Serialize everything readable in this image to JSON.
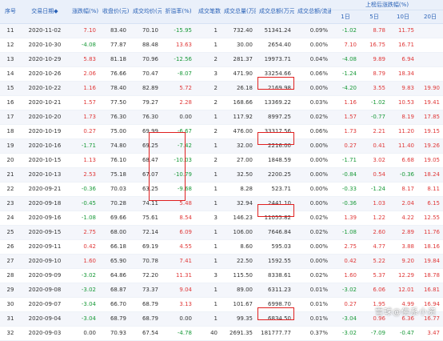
{
  "headers": {
    "top_group": "上榜后涨跌幅(%)",
    "cols": [
      "序号",
      "交易日期",
      "涨跌幅(%)",
      "收盘价(元)",
      "成交均价(元)",
      "折溢率(%)",
      "成交笔数",
      "成交总量(万股)",
      "成交总额(万元)",
      "成交总额/流通市值",
      "1日",
      "5日",
      "10日",
      "20日"
    ]
  },
  "rows": [
    [
      "11",
      "2020-11-02",
      "7.10",
      "83.40",
      "70.10",
      "-15.95",
      "1",
      "732.40",
      "51341.24",
      "0.09%",
      "-1.02",
      "8.78",
      "11.75",
      ""
    ],
    [
      "12",
      "2020-10-30",
      "-4.08",
      "77.87",
      "88.48",
      "13.63",
      "1",
      "30.00",
      "2654.40",
      "0.00%",
      "7.10",
      "16.75",
      "16.71",
      ""
    ],
    [
      "13",
      "2020-10-29",
      "5.83",
      "81.18",
      "70.96",
      "-12.56",
      "2",
      "281.37",
      "19973.71",
      "0.04%",
      "-4.08",
      "9.89",
      "6.94",
      ""
    ],
    [
      "14",
      "2020-10-26",
      "2.06",
      "76.66",
      "70.47",
      "-8.07",
      "3",
      "471.90",
      "33254.66",
      "0.06%",
      "-1.24",
      "8.79",
      "18.34",
      ""
    ],
    [
      "15",
      "2020-10-22",
      "1.16",
      "78.40",
      "82.89",
      "5.72",
      "2",
      "26.18",
      "2169.98",
      "0.00%",
      "-4.20",
      "3.55",
      "9.83",
      "19.90"
    ],
    [
      "16",
      "2020-10-21",
      "1.57",
      "77.50",
      "79.27",
      "2.28",
      "2",
      "168.66",
      "13369.22",
      "0.03%",
      "1.16",
      "-1.02",
      "10.53",
      "19.41"
    ],
    [
      "17",
      "2020-10-20",
      "1.73",
      "76.30",
      "76.30",
      "0.00",
      "1",
      "117.92",
      "8997.25",
      "0.02%",
      "1.57",
      "-0.77",
      "8.19",
      "17.85"
    ],
    [
      "18",
      "2020-10-19",
      "0.27",
      "75.00",
      "69.99",
      "-6.67",
      "2",
      "476.00",
      "33317.56",
      "0.06%",
      "1.73",
      "2.21",
      "11.20",
      "19.15"
    ],
    [
      "19",
      "2020-10-16",
      "-1.71",
      "74.80",
      "69.25",
      "-7.42",
      "1",
      "32.00",
      "2216.00",
      "0.00%",
      "0.27",
      "0.41",
      "11.40",
      "19.26"
    ],
    [
      "20",
      "2020-10-15",
      "1.13",
      "76.10",
      "68.47",
      "-10.03",
      "2",
      "27.00",
      "1848.59",
      "0.00%",
      "-1.71",
      "3.02",
      "6.68",
      "19.05"
    ],
    [
      "21",
      "2020-10-13",
      "2.53",
      "75.18",
      "67.07",
      "-10.79",
      "1",
      "32.50",
      "2200.25",
      "0.00%",
      "-0.84",
      "0.54",
      "-0.36",
      "18.24"
    ],
    [
      "22",
      "2020-09-21",
      "-0.36",
      "70.03",
      "63.25",
      "-9.68",
      "1",
      "8.28",
      "523.71",
      "0.00%",
      "-0.33",
      "-1.24",
      "8.17",
      "8.11"
    ],
    [
      "23",
      "2020-09-18",
      "-0.45",
      "70.28",
      "74.11",
      "5.48",
      "1",
      "32.94",
      "2441.10",
      "0.00%",
      "-0.36",
      "1.03",
      "2.04",
      "6.15"
    ],
    [
      "24",
      "2020-09-16",
      "-1.08",
      "69.66",
      "75.61",
      "8.54",
      "3",
      "146.23",
      "11055.82",
      "0.02%",
      "1.39",
      "1.22",
      "4.22",
      "12.55"
    ],
    [
      "25",
      "2020-09-15",
      "2.75",
      "68.00",
      "72.14",
      "6.09",
      "1",
      "106.00",
      "7646.84",
      "0.02%",
      "-1.08",
      "2.60",
      "2.89",
      "11.76"
    ],
    [
      "26",
      "2020-09-11",
      "0.42",
      "66.18",
      "69.19",
      "4.55",
      "1",
      "8.60",
      "595.03",
      "0.00%",
      "2.75",
      "4.77",
      "3.88",
      "18.16"
    ],
    [
      "27",
      "2020-09-10",
      "1.60",
      "65.90",
      "70.78",
      "7.41",
      "1",
      "22.50",
      "1592.55",
      "0.00%",
      "0.42",
      "5.22",
      "9.20",
      "19.84"
    ],
    [
      "28",
      "2020-09-09",
      "-3.02",
      "64.86",
      "72.20",
      "11.31",
      "3",
      "115.50",
      "8338.61",
      "0.02%",
      "1.60",
      "5.37",
      "12.29",
      "18.78"
    ],
    [
      "29",
      "2020-09-08",
      "-3.02",
      "68.87",
      "73.37",
      "9.04",
      "1",
      "89.00",
      "6311.23",
      "0.01%",
      "-3.02",
      "6.06",
      "12.01",
      "16.81"
    ],
    [
      "30",
      "2020-09-07",
      "-3.04",
      "66.70",
      "68.79",
      "3.13",
      "1",
      "101.67",
      "6998.70",
      "0.01%",
      "0.27",
      "1.95",
      "4.99",
      "16.94"
    ],
    [
      "31",
      "2020-09-04",
      "-3.04",
      "68.79",
      "68.79",
      "0.00",
      "1",
      "99.35",
      "6834.50",
      "0.01%",
      "-3.04",
      "0.96",
      "6.36",
      "16.77"
    ],
    [
      "32",
      "2020-09-03",
      "0.00",
      "70.93",
      "67.54",
      "-4.78",
      "40",
      "2691.35",
      "181777.77",
      "0.37%",
      "-3.02",
      "-7.09",
      "-0.47",
      "3.47"
    ]
  ],
  "watermark": "雪球@佛系小资"
}
